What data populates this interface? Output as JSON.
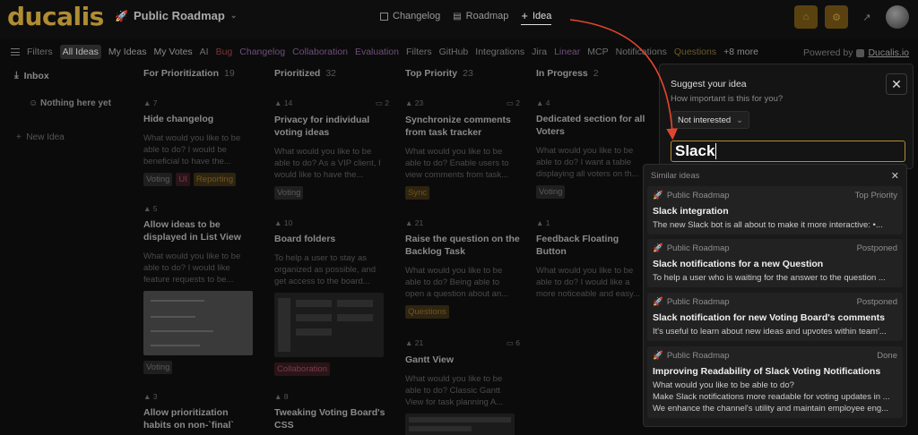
{
  "brand": {
    "logo": "ducalis",
    "roadmap_title": "Public Roadmap",
    "accent": "#b08c33"
  },
  "header_tabs": [
    {
      "label": "Changelog",
      "icon": "square-icon"
    },
    {
      "label": "Roadmap",
      "icon": "roadmap-icon"
    },
    {
      "label": "Idea",
      "icon": "plus-icon",
      "active": true
    }
  ],
  "filters": {
    "label": "Filters",
    "items": [
      {
        "label": "All Ideas",
        "style": "sel"
      },
      {
        "label": "My Ideas",
        "style": "white"
      },
      {
        "label": "My Votes",
        "style": "white"
      },
      {
        "label": "AI",
        "style": ""
      },
      {
        "label": "Bug",
        "style": "red"
      },
      {
        "label": "Changelog",
        "style": "purple"
      },
      {
        "label": "Collaboration",
        "style": "purple"
      },
      {
        "label": "Evaluation",
        "style": "purple"
      },
      {
        "label": "Filters",
        "style": ""
      },
      {
        "label": "GitHub",
        "style": ""
      },
      {
        "label": "Integrations",
        "style": ""
      },
      {
        "label": "Jira",
        "style": ""
      },
      {
        "label": "Linear",
        "style": "purple"
      },
      {
        "label": "MCP",
        "style": ""
      },
      {
        "label": "Notifications",
        "style": ""
      },
      {
        "label": "Questions",
        "style": "olive"
      },
      {
        "label": "+8 more",
        "style": "white"
      }
    ],
    "powered_prefix": "Powered by",
    "powered_brand": "Ducalis.io"
  },
  "inbox": {
    "title": "Inbox",
    "empty": "Nothing here yet",
    "new_idea": "New Idea"
  },
  "columns": [
    {
      "title": "For Prioritization",
      "count": "19",
      "cards": [
        {
          "votes": "7",
          "comments": "",
          "title": "Hide changelog",
          "desc": "What would you like to be able to do? I would be beneficial to have the...",
          "tags": [
            {
              "t": "Voting",
              "c": ""
            },
            {
              "t": "UI",
              "c": "pink"
            },
            {
              "t": "Reporting",
              "c": "gold"
            }
          ]
        },
        {
          "votes": "5",
          "comments": "",
          "title": "Allow ideas to be displayed in List View",
          "desc": "What would you like to be able to do? I would like feature requests to be...",
          "tags": [
            {
              "t": "Voting",
              "c": ""
            }
          ]
        },
        {
          "votes": "3",
          "comments": "",
          "title": "Allow prioritization habits on non-`final`",
          "desc": "",
          "tags": []
        }
      ]
    },
    {
      "title": "Prioritized",
      "count": "32",
      "cards": [
        {
          "votes": "14",
          "comments": "2",
          "title": "Privacy for individual voting ideas",
          "desc": "What would you like to be able to do? As a VIP client, I would like to have the...",
          "tags": [
            {
              "t": "Voting",
              "c": ""
            }
          ]
        },
        {
          "votes": "10",
          "comments": "",
          "title": "Board folders",
          "desc": "To help a user to stay as organized as possible, and get access to the board...",
          "tags": [
            {
              "t": "Collaboration",
              "c": "pink"
            }
          ]
        },
        {
          "votes": "8",
          "comments": "",
          "title": "Tweaking Voting Board's CSS",
          "desc": "",
          "tags": []
        }
      ]
    },
    {
      "title": "Top Priority",
      "count": "23",
      "cards": [
        {
          "votes": "23",
          "comments": "2",
          "title": "Synchronize comments from task tracker",
          "desc": "What would you like to be able to do? Enable users to view comments from task...",
          "tags": [
            {
              "t": "Sync",
              "c": "gold"
            }
          ]
        },
        {
          "votes": "21",
          "comments": "",
          "title": "Raise the question on the Backlog Task",
          "desc": "What would you like to be able to do? Being able to open a question about an...",
          "tags": [
            {
              "t": "Questions",
              "c": "gold"
            }
          ]
        },
        {
          "votes": "21",
          "comments": "6",
          "title": "Gantt View",
          "desc": "What would you like to be able to do? Classic Gantt View for task planning A...",
          "tags": []
        }
      ]
    },
    {
      "title": "In Progress",
      "count": "2",
      "cards": [
        {
          "votes": "4",
          "comments": "",
          "title": "Dedicated section for all Voters",
          "desc": "What would you like to be able to do? I want a table displaying all voters on th...",
          "tags": [
            {
              "t": "Voting",
              "c": ""
            }
          ]
        },
        {
          "votes": "1",
          "comments": "",
          "title": "Feedback Floating Button",
          "desc": "What would you like to be able to do? I would like a more noticeable and easy...",
          "tags": []
        }
      ]
    }
  ],
  "dialog": {
    "title": "Suggest your idea",
    "subtitle": "How important is this for you?",
    "importance": "Not interested",
    "input_value": "Slack",
    "close_icon": "close-icon"
  },
  "similar": {
    "title": "Similar ideas",
    "items": [
      {
        "board": "Public Roadmap",
        "status": "Top Priority",
        "title": "Slack integration",
        "desc": [
          "The new Slack bot is all about to make it more interactive: •..."
        ]
      },
      {
        "board": "Public Roadmap",
        "status": "Postponed",
        "title": "Slack notifications for a new Question",
        "desc": [
          "To help a user who is waiting for the answer to the question ..."
        ]
      },
      {
        "board": "Public Roadmap",
        "status": "Postponed",
        "title": "Slack notification for new Voting Board's comments",
        "desc": [
          "It's useful to learn about new ideas and upvotes within team'..."
        ]
      },
      {
        "board": "Public Roadmap",
        "status": "Done",
        "title": "Improving Readability of Slack Voting Notifications",
        "desc": [
          "What would you like to be able to do?",
          "Make Slack notifications more readable for voting updates in ...",
          "We enhance the channel's utility and maintain employee eng..."
        ]
      }
    ]
  }
}
